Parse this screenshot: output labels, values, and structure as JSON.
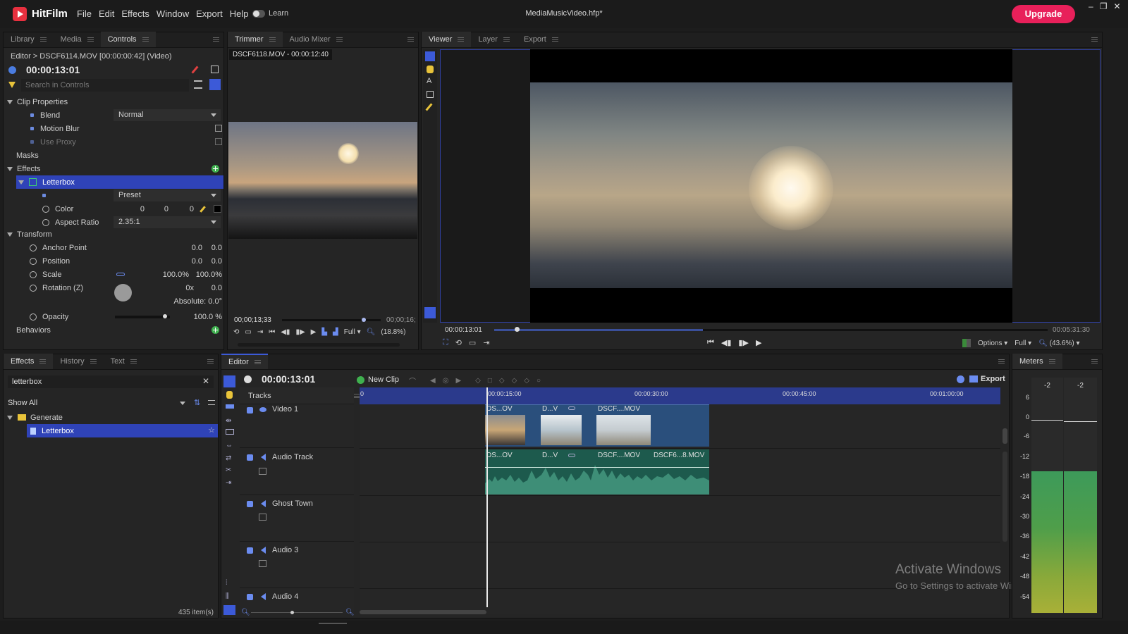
{
  "app": {
    "name": "HitFilm",
    "project_title": "MediaMusicVideo.hfp*",
    "learn_label": "Learn",
    "upgrade_label": "Upgrade"
  },
  "menu": [
    "File",
    "Edit",
    "Effects",
    "Window",
    "Export",
    "Help"
  ],
  "window_controls": [
    "–",
    "❐",
    "✕"
  ],
  "left_panel": {
    "tabs": [
      "Library",
      "Media",
      "Controls"
    ],
    "active_tab": "Controls",
    "breadcrumb": "Editor > DSCF6114.MOV [00:00:00:42] (Video)",
    "timecode": "00:00:13:01",
    "search_placeholder": "Search in Controls",
    "rows": {
      "clip_properties": "Clip Properties",
      "blend": "Blend",
      "blend_value": "Normal",
      "motion_blur": "Motion Blur",
      "use_proxy": "Use Proxy",
      "masks": "Masks",
      "effects": "Effects",
      "letterbox": "Letterbox",
      "preset": "Preset",
      "color": "Color",
      "color_r": "0",
      "color_g": "0",
      "color_b": "0",
      "aspect_ratio": "Aspect Ratio",
      "aspect_value": "2.35:1",
      "transform": "Transform",
      "anchor_point": "Anchor Point",
      "anchor_x": "0.0",
      "anchor_y": "0.0",
      "position": "Position",
      "position_x": "0.0",
      "position_y": "0.0",
      "scale": "Scale",
      "scale_x": "100.0%",
      "scale_y": "100.0%",
      "rotation": "Rotation (Z)",
      "rotation_turns": "0x",
      "rotation_deg": "0.0",
      "absolute": "Absolute: 0.0°",
      "opacity": "Opacity",
      "opacity_value": "100.0 %",
      "behaviors": "Behaviors"
    }
  },
  "trimmer": {
    "tabs": [
      "Trimmer",
      "Audio Mixer"
    ],
    "clip_label": "DSCF6118.MOV - 00:00:12:40",
    "time_in": "00;00;13;33",
    "time_out": "00;00;16;",
    "quality": "Full",
    "zoom": "(18.8%)"
  },
  "viewer": {
    "tabs": [
      "Viewer",
      "Layer",
      "Export"
    ],
    "time_current": "00:00:13:01",
    "time_total": "00:05:31:30",
    "options_label": "Options",
    "quality": "Full",
    "zoom": "(43.6%)"
  },
  "effects_panel": {
    "tabs": [
      "Effects",
      "History",
      "Text"
    ],
    "search_value": "letterbox",
    "filter": "Show All",
    "tree": [
      {
        "label": "Generate"
      },
      {
        "label": "Letterbox"
      }
    ],
    "item_count": "435 item(s)"
  },
  "editor": {
    "tab": "Editor",
    "timecode": "00:00:13:01",
    "new_clip_label": "New Clip",
    "export_label": "Export",
    "tracks_header": "Tracks",
    "ruler": [
      "0",
      "00:00:15:00",
      "00:00:30:00",
      "00:00:45:00",
      "00:01:00:00"
    ],
    "tracks": [
      "Video 1",
      "Audio Track",
      "Ghost Town",
      "Audio 3",
      "Audio 4"
    ],
    "video_clips": [
      "DS...OV",
      "D...V",
      "DSCF....MOV"
    ],
    "audio_clips": [
      "DS...OV",
      "D...V",
      "DSCF....MOV",
      "DSCF6...8.MOV"
    ]
  },
  "meters": {
    "tab": "Meters",
    "channel_peaks": [
      "-2",
      "-2"
    ],
    "scale": [
      "6",
      "0",
      "-6",
      "-12",
      "-18",
      "-24",
      "-30",
      "-36",
      "-42",
      "-48",
      "-54"
    ],
    "level_fraction": 0.6
  },
  "watermark": {
    "title": "Activate Windows",
    "subtitle": "Go to Settings to activate Windows."
  },
  "colors": {
    "accent": "#3c5ad8",
    "upgrade": "#e8205a",
    "selection": "#2f43b8",
    "video_clip": "#2a4f7c",
    "audio_clip": "#1d5a4d"
  }
}
